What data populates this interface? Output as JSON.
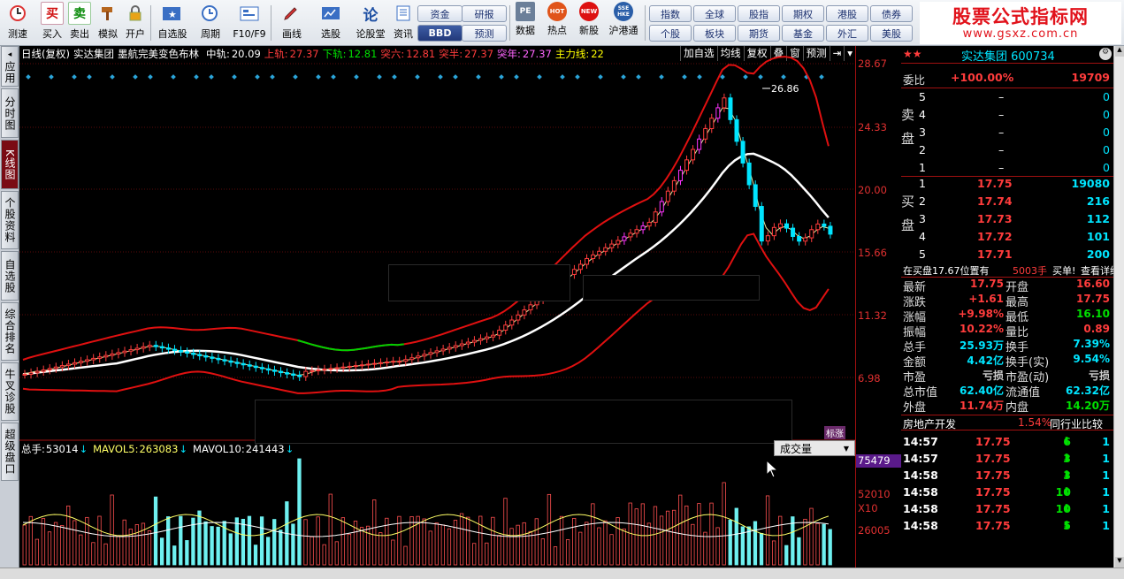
{
  "toolbar": {
    "buttons": [
      {
        "label": "测速",
        "icon": "speed-clock-icon"
      },
      {
        "label": "买入",
        "icon": "buy-icon",
        "glyph": "买"
      },
      {
        "label": "卖出",
        "icon": "sell-icon",
        "glyph": "卖"
      },
      {
        "label": "模拟",
        "icon": "hammer-icon"
      },
      {
        "label": "开户",
        "icon": "lock-icon"
      },
      {
        "label": "自选股",
        "icon": "star-folder-icon"
      },
      {
        "label": "周期",
        "icon": "clock-icon"
      },
      {
        "label": "F10/F9",
        "icon": "f10-icon"
      },
      {
        "label": "画线",
        "icon": "pencil-icon"
      },
      {
        "label": "选股",
        "icon": "select-stock-icon"
      },
      {
        "label": "论股堂",
        "icon": "forum-icon",
        "glyph": "论"
      },
      {
        "label": "资讯",
        "icon": "news-icon"
      },
      {
        "label": "数据",
        "icon": "pe-data-icon",
        "glyph": "PE"
      },
      {
        "label": "热点",
        "icon": "hot-icon",
        "glyph": "HOT"
      },
      {
        "label": "新股",
        "icon": "new-stock-icon",
        "glyph": "NEW"
      },
      {
        "label": "沪港通",
        "icon": "sse-hkex-icon",
        "glyph": "SSE HKE"
      }
    ],
    "pills_left": [
      [
        "资金",
        "研报"
      ],
      [
        "BBD",
        "预测"
      ]
    ],
    "pills_right": [
      [
        "指数",
        "全球",
        "股指",
        "期权",
        "港股",
        "债券"
      ],
      [
        "个股",
        "板块",
        "期货",
        "基金",
        "外汇",
        "美股"
      ]
    ]
  },
  "logo": {
    "line1": "股票公式指标网",
    "line2": "www.gsxz.com.cn"
  },
  "left_tabs": [
    "应用",
    "分时图",
    "K线图",
    "个股资料",
    "自选股",
    "综合排名",
    "牛叉诊股",
    "超级盘口"
  ],
  "chart": {
    "period_label": "日线(复权)",
    "stock_name": "实达集团",
    "indicator_name": "墨航完美变色布林",
    "fields": [
      {
        "label": "中轨:",
        "value": "20.09"
      },
      {
        "label": "上轨:",
        "value": "27.37"
      },
      {
        "label": "下轨:",
        "value": "12.81"
      },
      {
        "label": "突六:",
        "value": "12.81"
      },
      {
        "label": "突半:",
        "value": "27.37"
      },
      {
        "label": "突年:",
        "value": "27.37"
      },
      {
        "label": "主力线:",
        "value": "22"
      }
    ],
    "buttons": [
      "加自选",
      "均线",
      "复权",
      "叠",
      "窗",
      "预测"
    ],
    "peak_label": "26.86",
    "badge": "标涨",
    "price_ticks": [
      "28.67",
      "24.33",
      "20.00",
      "15.66",
      "11.32",
      "6.98"
    ],
    "volume": {
      "label": "总手:",
      "value": "53014",
      "ma5_label": "MAVOL5:",
      "ma5": "263083",
      "ma10_label": "MAVOL10:",
      "ma10": "241443",
      "selector": "成交量",
      "ticks": [
        "75479",
        "52010",
        "X10",
        "26005"
      ]
    }
  },
  "quote": {
    "title": "实达集团 600734",
    "weibi_label": "委比",
    "weibi": "+100.00%",
    "weicha": "19709",
    "sell_label": "卖盘",
    "sell": [
      {
        "lv": "5",
        "price": "–",
        "vol": "0"
      },
      {
        "lv": "4",
        "price": "–",
        "vol": "0"
      },
      {
        "lv": "3",
        "price": "–",
        "vol": "0"
      },
      {
        "lv": "2",
        "price": "–",
        "vol": "0"
      },
      {
        "lv": "1",
        "price": "–",
        "vol": "0"
      }
    ],
    "buy_label": "买盘",
    "buy": [
      {
        "lv": "1",
        "price": "17.75",
        "vol": "19080"
      },
      {
        "lv": "2",
        "price": "17.74",
        "vol": "216"
      },
      {
        "lv": "3",
        "price": "17.73",
        "vol": "112"
      },
      {
        "lv": "4",
        "price": "17.72",
        "vol": "101"
      },
      {
        "lv": "5",
        "price": "17.71",
        "vol": "200"
      }
    ],
    "notice": {
      "pre": "在买盘17.67位置有",
      "vol": "5003手",
      "mid": "买单!",
      "link": "查看详细"
    },
    "stats": [
      [
        "最新",
        "17.75",
        "开盘",
        "16.60"
      ],
      [
        "涨跌",
        "+1.61",
        "最高",
        "17.75"
      ],
      [
        "涨幅",
        "+9.98%",
        "最低",
        "16.10"
      ],
      [
        "振幅",
        "10.22%",
        "量比",
        "0.89"
      ],
      [
        "总手",
        "25.93万",
        "换手",
        "7.39%"
      ],
      [
        "金额",
        "4.42亿",
        "换手(实)",
        "9.54%"
      ],
      [
        "市盈",
        "亏损",
        "市盈(动)",
        "亏损"
      ],
      [
        "总市值",
        "62.40亿",
        "流通值",
        "62.32亿"
      ],
      [
        "外盘",
        "11.74万",
        "内盘",
        "14.20万"
      ]
    ],
    "sector": {
      "name": "房地产开发",
      "pct": "1.54%",
      "compare": "同行业比较"
    },
    "ticks": [
      {
        "time": "14:57",
        "price": "17.75",
        "vol": "6",
        "n": "1"
      },
      {
        "time": "14:57",
        "price": "17.75",
        "vol": "3",
        "n": "1"
      },
      {
        "time": "14:58",
        "price": "17.75",
        "vol": "3",
        "n": "1"
      },
      {
        "time": "14:58",
        "price": "17.75",
        "vol": "10",
        "n": "1"
      },
      {
        "time": "14:58",
        "price": "17.75",
        "vol": "10",
        "n": "1"
      },
      {
        "time": "14:58",
        "price": "17.75",
        "vol": "5",
        "n": "1"
      }
    ]
  },
  "colors": {
    "up": "#ff3c3c",
    "down": "#00e5ff",
    "mid_line": "#ffffff",
    "band": "#e01010",
    "green_band": "#00d000"
  }
}
